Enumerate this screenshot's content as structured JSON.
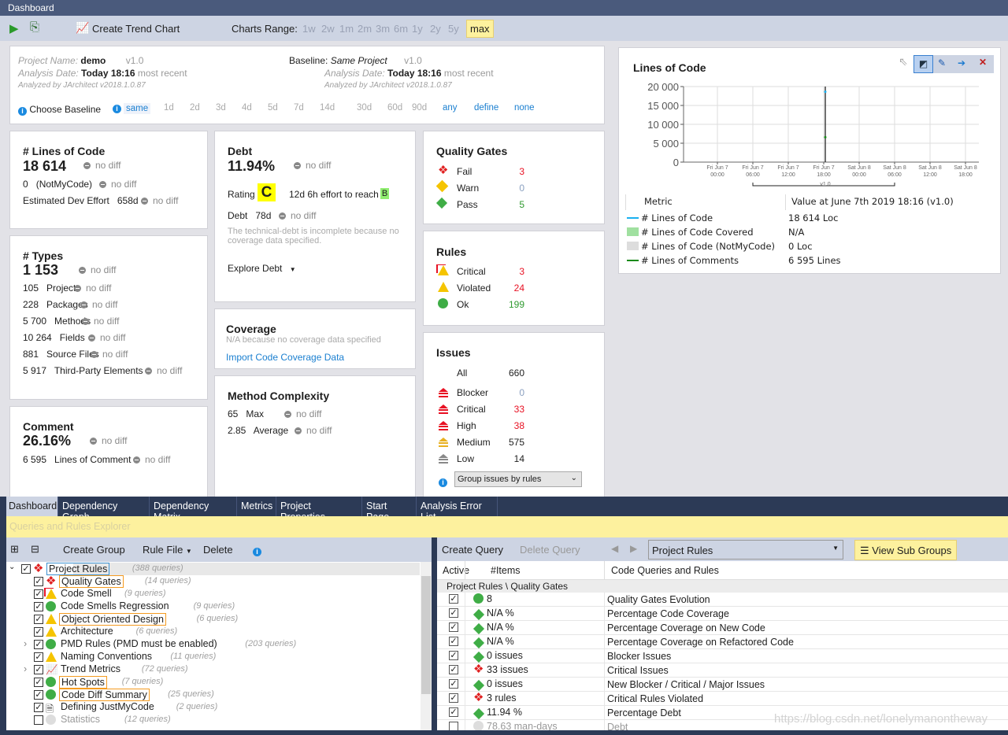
{
  "window": {
    "title": "Dashboard"
  },
  "toolbar": {
    "create_trend": "Create Trend Chart",
    "charts_range_label": "Charts Range:",
    "ranges": [
      "1w",
      "2w",
      "1m",
      "2m",
      "3m",
      "6m",
      "1y",
      "2y",
      "5y",
      "max"
    ],
    "selected_range": "max"
  },
  "project": {
    "name_label": "Project Name:",
    "name": "demo",
    "version": "v1.0",
    "date_label": "Analysis Date:",
    "date": "Today 18:16",
    "most_recent": "most recent",
    "analyzed_by": "Analyzed by JArchitect v2018.1.0.87",
    "baseline_label": "Baseline:",
    "baseline": "Same Project",
    "baseline_version": "v1.0",
    "baseline_date": "Today 18:16",
    "baseline_most_recent": "most recent",
    "baseline_analyzed_by": "Analyzed by JArchitect v2018.1.0.87",
    "choose_baseline": "Choose Baseline",
    "baseline_options": [
      "same",
      "1d",
      "2d",
      "3d",
      "4d",
      "5d",
      "7d",
      "14d",
      "30d",
      "60d",
      "90d",
      "any",
      "define",
      "none"
    ]
  },
  "no_diff": "no diff",
  "loc": {
    "title": "# Lines of Code",
    "value": "18 614",
    "notmycode_value": "0",
    "notmycode_label": "(NotMyCode)",
    "effort_label": "Estimated Dev Effort",
    "effort": "658d"
  },
  "types": {
    "title": "# Types",
    "value": "1 153",
    "items": [
      {
        "v": "105",
        "l": "Projects"
      },
      {
        "v": "228",
        "l": "Packages"
      },
      {
        "v": "5 700",
        "l": "Methods"
      },
      {
        "v": "10 264",
        "l": "Fields"
      },
      {
        "v": "881",
        "l": "Source Files"
      },
      {
        "v": "5 917",
        "l": "Third-Party Elements"
      }
    ]
  },
  "comment": {
    "title": "Comment",
    "value": "26.16%",
    "lines_value": "6 595",
    "lines_label": "Lines of Comment"
  },
  "debt": {
    "title": "Debt",
    "value": "11.94%",
    "rating_label": "Rating",
    "rating": "C",
    "effort": "12d  6h effort to reach",
    "target_rating": "B",
    "debt_label": "Debt",
    "debt_value": "78d",
    "note": "The technical-debt is incomplete because no coverage data specified.",
    "explore": "Explore Debt"
  },
  "coverage": {
    "title": "Coverage",
    "note": "N/A because no coverage data specified",
    "import": "Import Code Coverage Data"
  },
  "complexity": {
    "title": "Method Complexity",
    "max_value": "65",
    "max_label": "Max",
    "avg_value": "2.85",
    "avg_label": "Average"
  },
  "quality_gates": {
    "title": "Quality Gates",
    "items": [
      {
        "l": "Fail",
        "v": "3",
        "icon": "fail"
      },
      {
        "l": "Warn",
        "v": "0",
        "icon": "warn"
      },
      {
        "l": "Pass",
        "v": "5",
        "icon": "pass"
      }
    ]
  },
  "rules": {
    "title": "Rules",
    "items": [
      {
        "l": "Critical",
        "v": "3",
        "icon": "critical-warning"
      },
      {
        "l": "Violated",
        "v": "24",
        "icon": "warning"
      },
      {
        "l": "Ok",
        "v": "199",
        "icon": "ok"
      }
    ]
  },
  "issues": {
    "title": "Issues",
    "all_label": "All",
    "all": "660",
    "items": [
      {
        "l": "Blocker",
        "v": "0",
        "color": "#e81123"
      },
      {
        "l": "Critical",
        "v": "33",
        "color": "#e81123"
      },
      {
        "l": "High",
        "v": "38",
        "color": "#e81123"
      },
      {
        "l": "Medium",
        "v": "575",
        "color": "#e8b020"
      },
      {
        "l": "Low",
        "v": "14",
        "color": "#888888"
      }
    ],
    "group_by": "Group issues by rules"
  },
  "chart_data": {
    "type": "line",
    "title": "Lines of Code",
    "ylim": [
      0,
      20000
    ],
    "yticks": [
      "0",
      "5 000",
      "10 000",
      "15 000",
      "20 000"
    ],
    "xticks": [
      [
        "Fri Jun 7",
        "00:00"
      ],
      [
        "Fri Jun 7",
        "06:00"
      ],
      [
        "Fri Jun 7",
        "12:00"
      ],
      [
        "Fri Jun 7",
        "18:00"
      ],
      [
        "Sat Jun 8",
        "00:00"
      ],
      [
        "Sat Jun 8",
        "06:00"
      ],
      [
        "Sat Jun 8",
        "12:00"
      ],
      [
        "Sat Jun 8",
        "18:00"
      ]
    ],
    "version_marker": "v1.0",
    "grid": true,
    "series": [
      {
        "name": "# Lines of Code",
        "x": "2019-06-07 18:16",
        "y": 18614,
        "color": "#1ab0f0"
      },
      {
        "name": "# Lines of Comments",
        "x": "2019-06-07 18:16",
        "y": 6595,
        "color": "#1a8a1a"
      }
    ],
    "legend_header": [
      "Metric",
      "Value at June 7th 2019  18:16  (v1.0)"
    ],
    "legend": [
      {
        "name": "# Lines of Code",
        "value": "18 614 Loc",
        "color": "#1ab0f0",
        "kind": "line"
      },
      {
        "name": "# Lines of Code Covered",
        "value": "N/A",
        "color": "#a0e0a0",
        "kind": "box"
      },
      {
        "name": "# Lines of Code (NotMyCode)",
        "value": "0 Loc",
        "color": "#dddddd",
        "kind": "box"
      },
      {
        "name": "# Lines of Comments",
        "value": "6 595 Lines",
        "color": "#1a8a1a",
        "kind": "line"
      }
    ]
  },
  "tabs": [
    "Dashboard",
    "Dependency Graph",
    "Dependency Matrix",
    "Metrics",
    "Project Properties",
    "Start Page",
    "Analysis Error List"
  ],
  "explorer": {
    "title": "Queries and Rules Explorer",
    "create_group": "Create Group",
    "rule_file": "Rule File",
    "delete": "Delete",
    "tree": [
      {
        "label": "Project Rules",
        "count": "(388 queries)",
        "icon": "fail",
        "level": 0,
        "checked": true,
        "highlight": "blue",
        "expanded": true
      },
      {
        "label": "Quality Gates",
        "count": "(14 queries)",
        "icon": "fail",
        "level": 1,
        "checked": true,
        "highlight": "orange"
      },
      {
        "label": "Code Smell",
        "count": "(9 queries)",
        "icon": "critical-warning",
        "level": 1,
        "checked": true
      },
      {
        "label": "Code Smells Regression",
        "count": "(9 queries)",
        "icon": "ok",
        "level": 1,
        "checked": true
      },
      {
        "label": "Object Oriented Design",
        "count": "(6 queries)",
        "icon": "warning",
        "level": 1,
        "checked": true,
        "highlight": "orange"
      },
      {
        "label": "Architecture",
        "count": "(6 queries)",
        "icon": "warning",
        "level": 1,
        "checked": true
      },
      {
        "label": "PMD Rules (PMD must be enabled)",
        "count": "(203 queries)",
        "icon": "ok",
        "level": 1,
        "checked": true,
        "expander": true
      },
      {
        "label": "Naming Conventions",
        "count": "(11 queries)",
        "icon": "warning",
        "level": 1,
        "checked": true
      },
      {
        "label": "Trend Metrics",
        "count": "(72 queries)",
        "icon": "trend",
        "level": 1,
        "checked": true,
        "expander": true
      },
      {
        "label": "Hot Spots",
        "count": "(7 queries)",
        "icon": "ok",
        "level": 1,
        "checked": true,
        "highlight": "orange"
      },
      {
        "label": "Code Diff Summary",
        "count": "(25 queries)",
        "icon": "ok",
        "level": 1,
        "checked": true,
        "highlight": "orange"
      },
      {
        "label": "Defining JustMyCode",
        "count": "(2 queries)",
        "icon": "document",
        "level": 1,
        "checked": true
      },
      {
        "label": "Statistics",
        "count": "(12 queries)",
        "icon": "disabled",
        "level": 1,
        "checked": false
      }
    ]
  },
  "queries": {
    "create": "Create Query",
    "delete": "Delete Query",
    "group_select": "Project Rules",
    "view_sub_groups": "View Sub Groups",
    "columns": [
      "Active",
      "#Items",
      "Code Queries and Rules"
    ],
    "group_row": "Project Rules \\ Quality Gates",
    "rows": [
      {
        "items": "8",
        "name": "Quality Gates Evolution",
        "icon": "ok",
        "active": true
      },
      {
        "items": "N/A %",
        "name": "Percentage Code Coverage",
        "icon": "pass",
        "active": true
      },
      {
        "items": "N/A %",
        "name": "Percentage Coverage on New Code",
        "icon": "pass",
        "active": true
      },
      {
        "items": "N/A %",
        "name": "Percentage Coverage on Refactored Code",
        "icon": "pass",
        "active": true
      },
      {
        "items": "0 issues",
        "name": "Blocker Issues",
        "icon": "pass",
        "active": true
      },
      {
        "items": "33 issues",
        "name": "Critical Issues",
        "icon": "fail",
        "active": true
      },
      {
        "items": "0 issues",
        "name": "New Blocker / Critical / Major Issues",
        "icon": "pass",
        "active": true
      },
      {
        "items": "3 rules",
        "name": "Critical Rules Violated",
        "icon": "fail",
        "active": true
      },
      {
        "items": "11.94 %",
        "name": "Percentage Debt",
        "icon": "pass",
        "active": true
      },
      {
        "items": "78.63 man-days",
        "name": "Debt",
        "icon": "disabled",
        "active": false
      }
    ]
  },
  "watermark": "https://blog.csdn.net/lonelymanontheway"
}
